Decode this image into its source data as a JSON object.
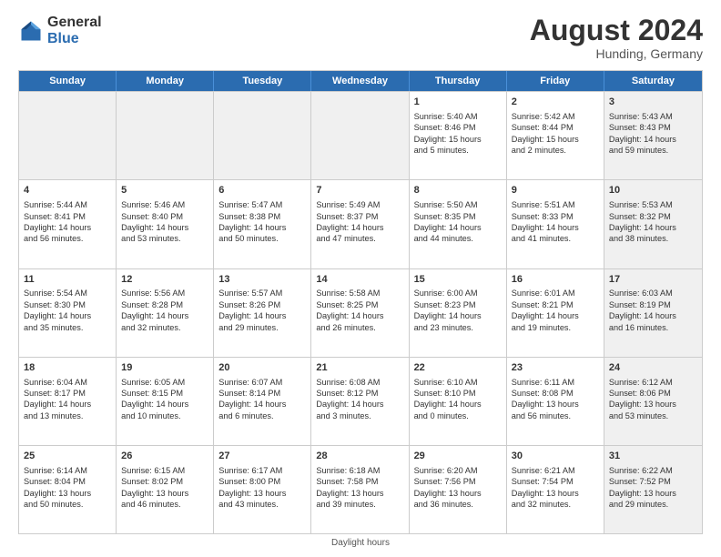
{
  "logo": {
    "general": "General",
    "blue": "Blue"
  },
  "title": "August 2024",
  "location": "Hunding, Germany",
  "header_days": [
    "Sunday",
    "Monday",
    "Tuesday",
    "Wednesday",
    "Thursday",
    "Friday",
    "Saturday"
  ],
  "footer": "Daylight hours",
  "weeks": [
    [
      {
        "day": "",
        "content": "",
        "shaded": true
      },
      {
        "day": "",
        "content": "",
        "shaded": true
      },
      {
        "day": "",
        "content": "",
        "shaded": true
      },
      {
        "day": "",
        "content": "",
        "shaded": true
      },
      {
        "day": "1",
        "content": "Sunrise: 5:40 AM\nSunset: 8:46 PM\nDaylight: 15 hours\nand 5 minutes."
      },
      {
        "day": "2",
        "content": "Sunrise: 5:42 AM\nSunset: 8:44 PM\nDaylight: 15 hours\nand 2 minutes."
      },
      {
        "day": "3",
        "content": "Sunrise: 5:43 AM\nSunset: 8:43 PM\nDaylight: 14 hours\nand 59 minutes.",
        "shaded": true
      }
    ],
    [
      {
        "day": "4",
        "content": "Sunrise: 5:44 AM\nSunset: 8:41 PM\nDaylight: 14 hours\nand 56 minutes."
      },
      {
        "day": "5",
        "content": "Sunrise: 5:46 AM\nSunset: 8:40 PM\nDaylight: 14 hours\nand 53 minutes."
      },
      {
        "day": "6",
        "content": "Sunrise: 5:47 AM\nSunset: 8:38 PM\nDaylight: 14 hours\nand 50 minutes."
      },
      {
        "day": "7",
        "content": "Sunrise: 5:49 AM\nSunset: 8:37 PM\nDaylight: 14 hours\nand 47 minutes."
      },
      {
        "day": "8",
        "content": "Sunrise: 5:50 AM\nSunset: 8:35 PM\nDaylight: 14 hours\nand 44 minutes."
      },
      {
        "day": "9",
        "content": "Sunrise: 5:51 AM\nSunset: 8:33 PM\nDaylight: 14 hours\nand 41 minutes."
      },
      {
        "day": "10",
        "content": "Sunrise: 5:53 AM\nSunset: 8:32 PM\nDaylight: 14 hours\nand 38 minutes.",
        "shaded": true
      }
    ],
    [
      {
        "day": "11",
        "content": "Sunrise: 5:54 AM\nSunset: 8:30 PM\nDaylight: 14 hours\nand 35 minutes."
      },
      {
        "day": "12",
        "content": "Sunrise: 5:56 AM\nSunset: 8:28 PM\nDaylight: 14 hours\nand 32 minutes."
      },
      {
        "day": "13",
        "content": "Sunrise: 5:57 AM\nSunset: 8:26 PM\nDaylight: 14 hours\nand 29 minutes."
      },
      {
        "day": "14",
        "content": "Sunrise: 5:58 AM\nSunset: 8:25 PM\nDaylight: 14 hours\nand 26 minutes."
      },
      {
        "day": "15",
        "content": "Sunrise: 6:00 AM\nSunset: 8:23 PM\nDaylight: 14 hours\nand 23 minutes."
      },
      {
        "day": "16",
        "content": "Sunrise: 6:01 AM\nSunset: 8:21 PM\nDaylight: 14 hours\nand 19 minutes."
      },
      {
        "day": "17",
        "content": "Sunrise: 6:03 AM\nSunset: 8:19 PM\nDaylight: 14 hours\nand 16 minutes.",
        "shaded": true
      }
    ],
    [
      {
        "day": "18",
        "content": "Sunrise: 6:04 AM\nSunset: 8:17 PM\nDaylight: 14 hours\nand 13 minutes."
      },
      {
        "day": "19",
        "content": "Sunrise: 6:05 AM\nSunset: 8:15 PM\nDaylight: 14 hours\nand 10 minutes."
      },
      {
        "day": "20",
        "content": "Sunrise: 6:07 AM\nSunset: 8:14 PM\nDaylight: 14 hours\nand 6 minutes."
      },
      {
        "day": "21",
        "content": "Sunrise: 6:08 AM\nSunset: 8:12 PM\nDaylight: 14 hours\nand 3 minutes."
      },
      {
        "day": "22",
        "content": "Sunrise: 6:10 AM\nSunset: 8:10 PM\nDaylight: 14 hours\nand 0 minutes."
      },
      {
        "day": "23",
        "content": "Sunrise: 6:11 AM\nSunset: 8:08 PM\nDaylight: 13 hours\nand 56 minutes."
      },
      {
        "day": "24",
        "content": "Sunrise: 6:12 AM\nSunset: 8:06 PM\nDaylight: 13 hours\nand 53 minutes.",
        "shaded": true
      }
    ],
    [
      {
        "day": "25",
        "content": "Sunrise: 6:14 AM\nSunset: 8:04 PM\nDaylight: 13 hours\nand 50 minutes."
      },
      {
        "day": "26",
        "content": "Sunrise: 6:15 AM\nSunset: 8:02 PM\nDaylight: 13 hours\nand 46 minutes."
      },
      {
        "day": "27",
        "content": "Sunrise: 6:17 AM\nSunset: 8:00 PM\nDaylight: 13 hours\nand 43 minutes."
      },
      {
        "day": "28",
        "content": "Sunrise: 6:18 AM\nSunset: 7:58 PM\nDaylight: 13 hours\nand 39 minutes."
      },
      {
        "day": "29",
        "content": "Sunrise: 6:20 AM\nSunset: 7:56 PM\nDaylight: 13 hours\nand 36 minutes."
      },
      {
        "day": "30",
        "content": "Sunrise: 6:21 AM\nSunset: 7:54 PM\nDaylight: 13 hours\nand 32 minutes."
      },
      {
        "day": "31",
        "content": "Sunrise: 6:22 AM\nSunset: 7:52 PM\nDaylight: 13 hours\nand 29 minutes.",
        "shaded": true
      }
    ]
  ]
}
